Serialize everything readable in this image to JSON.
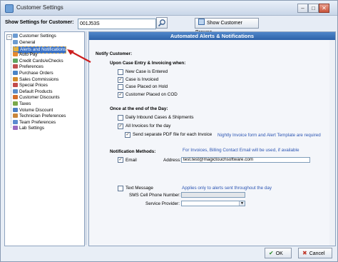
{
  "window": {
    "title": "Customer Settings",
    "controls": {
      "minimize": "–",
      "maximize": "□",
      "close": "✕"
    }
  },
  "toolbar": {
    "show_settings_label": "Show Settings for Customer:",
    "customer_value": "001J53S",
    "browse_label": "Show Customer Browse"
  },
  "tree": {
    "root": "Customer Settings",
    "items": [
      {
        "label": "General",
        "color": "#6c9bd1"
      },
      {
        "label": "Alerts and Notifications",
        "color": "#e3b341"
      },
      {
        "label": "Auto Pay",
        "color": "#e68a2e"
      },
      {
        "label": "Credit Cards/eChecks",
        "color": "#5fa65f"
      },
      {
        "label": "Preferences",
        "color": "#c05050"
      },
      {
        "label": "Purchase Orders",
        "color": "#4b84c7"
      },
      {
        "label": "Sales Commissions",
        "color": "#d48b2a"
      },
      {
        "label": "Special Prices",
        "color": "#c24b4b"
      },
      {
        "label": "Default Products",
        "color": "#5c8dc9"
      },
      {
        "label": "Customer Discounts",
        "color": "#d46d2a"
      },
      {
        "label": "Taxes",
        "color": "#7aa84a"
      },
      {
        "label": "Volume Discount",
        "color": "#4d7fc4"
      },
      {
        "label": "Technician Preferences",
        "color": "#c9863a"
      },
      {
        "label": "Team Preferences",
        "color": "#5b8ad0"
      },
      {
        "label": "Lab Settings",
        "color": "#9a6ac0"
      }
    ],
    "selected_index": 1
  },
  "panel": {
    "header": "Automated Alerts & Notifications",
    "notify_customer": "Notify Customer:",
    "upon_case": "Upon Case Entry & Invoicing when:",
    "case_options": [
      {
        "label": "New Case is Entered",
        "checked": false
      },
      {
        "label": "Case is Invoiced",
        "checked": true
      },
      {
        "label": "Case Placed on Hold",
        "checked": false
      },
      {
        "label": "Customer Placed on COD",
        "checked": true
      }
    ],
    "end_of_day": "Once at the end of the Day:",
    "day_options": [
      {
        "label": "Daily Inbound Cases & Shipments",
        "checked": false
      },
      {
        "label": "All Invoices for the day",
        "checked": true
      }
    ],
    "send_pdf_label": "Send separate PDF file for each Invoice",
    "send_pdf_checked": true,
    "nightly_note": "Nightly Invoice form and Alert Template are required",
    "methods_label": "Notification Methods:",
    "billing_note": "For Invoices, Billing Contact Email will be used, if available",
    "email_label": "Email",
    "email_checked": true,
    "address_label": "Address:",
    "address_value": "test.test@magictouchsoftware.com",
    "text_message_label": "Text Message",
    "text_message_checked": false,
    "text_note": "Applies only to alerts sent throughout the day",
    "sms_label": "SMS Cell Phone Number:",
    "provider_label": "Service Provider:"
  },
  "buttons": {
    "ok": "OK",
    "cancel": "Cancel"
  },
  "colors": {
    "accent": "#2d62a8",
    "annotation_arrow": "#cc1f1f",
    "note": "#2c55b3"
  }
}
